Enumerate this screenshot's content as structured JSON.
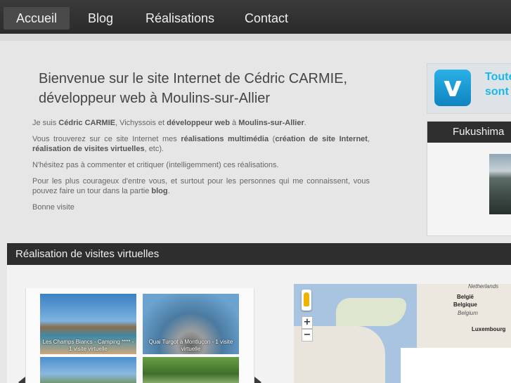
{
  "nav": {
    "items": [
      {
        "label": "Accueil",
        "active": true
      },
      {
        "label": "Blog",
        "active": false
      },
      {
        "label": "Réalisations",
        "active": false
      },
      {
        "label": "Contact",
        "active": false
      }
    ]
  },
  "welcome": {
    "title_line1": "Bienvenue sur le site Internet de Cédric CARMIE,",
    "title_line2": "développeur web à Moulins-sur-Allier",
    "p1": {
      "a": "Je suis ",
      "b": "Cédric CARMIE",
      "c": ", Vichyssois et ",
      "d": "développeur web",
      "e": " à ",
      "f": "Moulins-sur-Allier",
      "g": "."
    },
    "p2": {
      "a": "Vous trouverez sur ce site Internet mes ",
      "b": "réalisations multimédia",
      "c": " (",
      "d": "création de site Internet",
      "e": ", ",
      "f": "réalisation de visites virtuelles",
      "g": ", etc)."
    },
    "p3": "N'hésitez pas à commenter et critiquer (intelligemment) ces réalisations.",
    "p4": {
      "a": "Pour les plus courageux d'entre vous, et surtout pour les personnes qui me connaissent, vous pouvez faire un tour dans la partie ",
      "b": "blog",
      "c": "."
    },
    "p5": "Bonne visite"
  },
  "vimeo": {
    "logo": "v",
    "line1": "Toute",
    "line2": "sont"
  },
  "fukushima": {
    "title": "Fukushima"
  },
  "realisations": {
    "title": "Réalisation de visites virtuelles",
    "thumbs": [
      {
        "caption": "Les Champs Blancs - Camping **** - 1 visite virtuelle"
      },
      {
        "caption": "Quai Turgot à Montluçon - 1 visite virtuelle"
      },
      {
        "caption": ""
      },
      {
        "caption": ""
      }
    ]
  },
  "map": {
    "labels": {
      "netherlands": "Netherlands",
      "belgie": "België",
      "belgique": "Belgique",
      "belgium": "Belgium",
      "luxembourg": "Luxembourg"
    },
    "zoom_in": "+",
    "zoom_out": "−"
  },
  "colors": {
    "vimeo_blue": "#1ab7ea",
    "nav_bg": "#2a2a2a",
    "section_header": "#2e2e2e"
  }
}
